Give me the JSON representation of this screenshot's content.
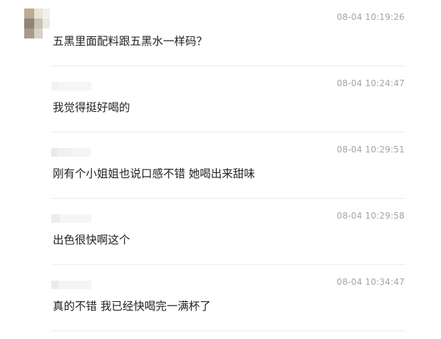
{
  "comments": [
    {
      "timestamp": "08-04 10:19:26",
      "text": "五黑里面配料跟五黑水一样码？"
    },
    {
      "timestamp": "08-04 10:24:47",
      "text": "我觉得挺好喝的"
    },
    {
      "timestamp": "08-04 10:29:51",
      "text": "刚有个小姐姐也说口感不错 她喝出来甜味"
    },
    {
      "timestamp": "08-04 10:29:58",
      "text": "出色很快啊这个"
    },
    {
      "timestamp": "08-04 10:34:47",
      "text": "真的不错 我已经快喝完一满杯了"
    }
  ]
}
